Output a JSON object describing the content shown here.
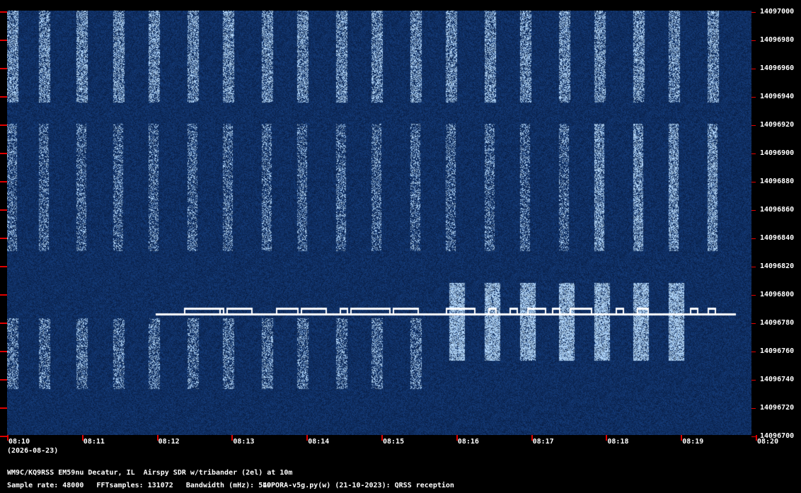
{
  "y_axis": {
    "labels": [
      "14097000",
      "14096980",
      "14096960",
      "14096940",
      "14096920",
      "14096900",
      "14096880",
      "14096860",
      "14096840",
      "14096820",
      "14096800",
      "14096780",
      "14096760",
      "14096740",
      "14096720",
      "14096700"
    ]
  },
  "x_axis": {
    "labels": [
      "08:10",
      "08:11",
      "08:12",
      "08:13",
      "08:14",
      "08:15",
      "08:16",
      "08:17",
      "08:18",
      "08:19",
      "08:20"
    ],
    "date": "(2026-08-23)"
  },
  "footer": {
    "station": "WM9C/KQ9RSS EM59nu Decatur, IL  Airspy SDR w/tribander (2el) at 10m",
    "params": "Sample rate: 48000   FFTsamples: 131072   Bandwidth (mHz): 549",
    "software": "LOPORA-v5g.py(w) (21-10-2023): QRSS reception"
  },
  "colors": {
    "background": "#0a2a5e",
    "signal": "#ffffff",
    "tick": "#e00000"
  }
}
